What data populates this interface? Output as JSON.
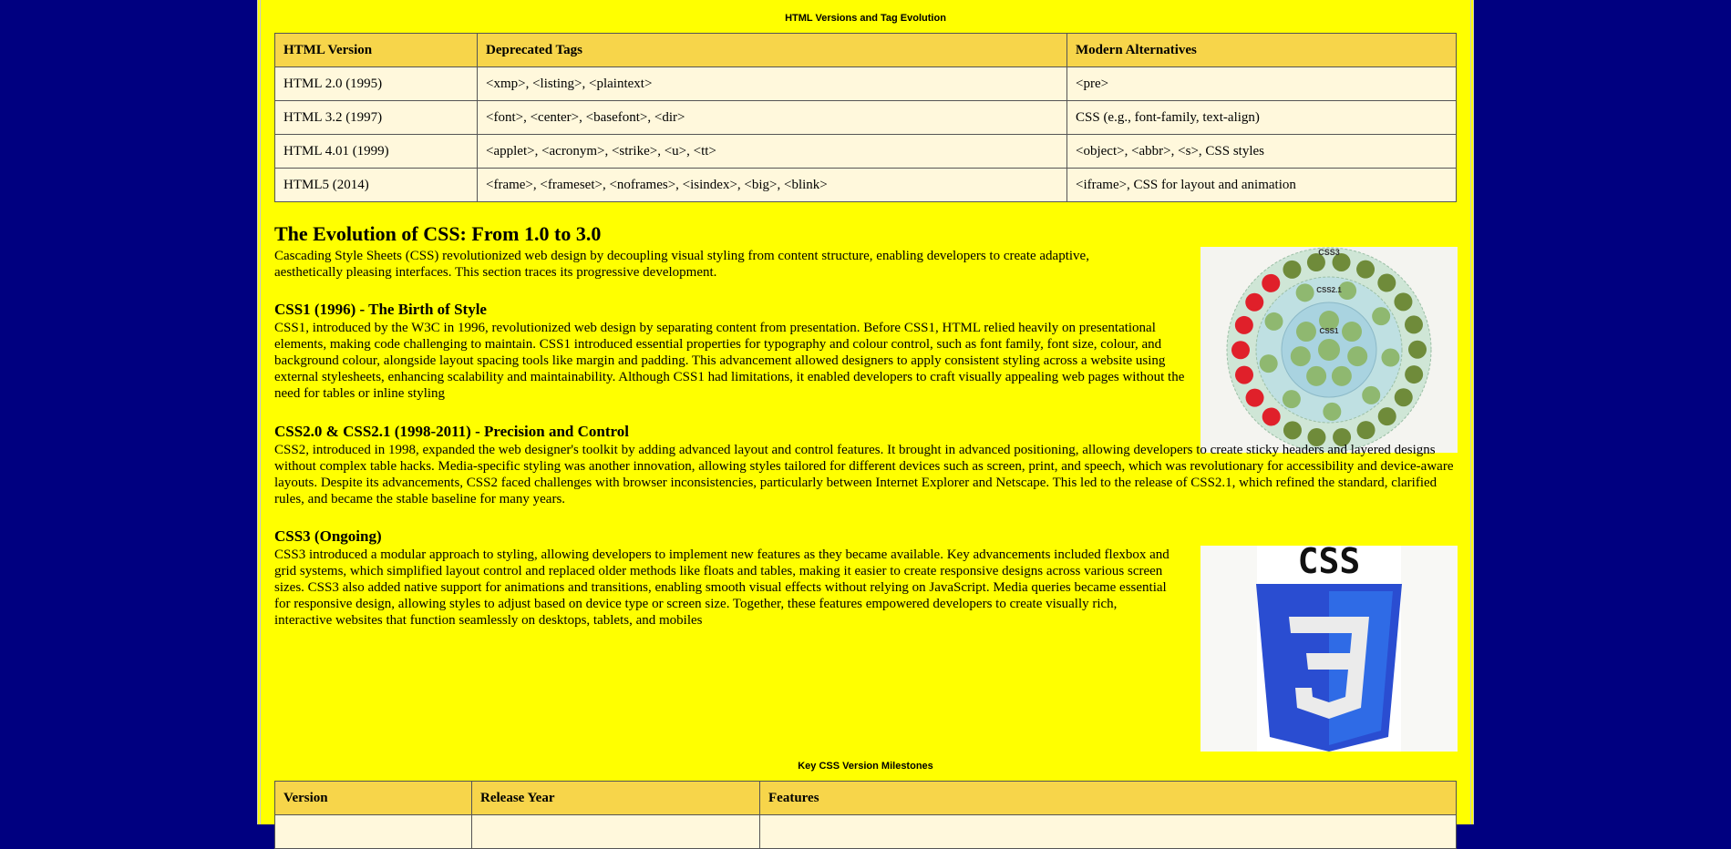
{
  "table1": {
    "caption": "HTML Versions and Tag Evolution",
    "headers": [
      "HTML Version",
      "Deprecated Tags",
      "Modern Alternatives"
    ],
    "rows": [
      [
        "HTML 2.0 (1995)",
        "<xmp>, <listing>, <plaintext>",
        "<pre>"
      ],
      [
        "HTML 3.2 (1997)",
        "<font>, <center>, <basefont>, <dir>",
        "CSS (e.g., font-family, text-align)"
      ],
      [
        "HTML 4.01 (1999)",
        "<applet>, <acronym>, <strike>, <u>, <tt>",
        "<object>, <abbr>, <s>, CSS styles"
      ],
      [
        "HTML5 (2014)",
        "<frame>, <frameset>, <noframes>, <isindex>, <big>, <blink>",
        "<iframe>, CSS for layout and animation"
      ]
    ]
  },
  "css_section": {
    "title": "The Evolution of CSS: From 1.0 to 3.0",
    "intro": "Cascading Style Sheets (CSS) revolutionized web design by decoupling visual styling from content structure, enabling developers to create adaptive, aesthetically pleasing interfaces. This section traces its progressive development.",
    "css1_title": "CSS1 (1996) - The Birth of Style",
    "css1_text": "CSS1, introduced by the W3C in 1996, revolutionized web design by separating content from presentation. Before CSS1, HTML relied heavily on presentational elements, making code challenging to maintain. CSS1 introduced essential properties for typography and colour control, such as font family, font size, colour, and background colour, alongside layout spacing tools like margin and padding. This advancement allowed designers to apply consistent styling across a website using external stylesheets, enhancing scalability and maintainability. Although CSS1 had limitations, it enabled developers to craft visually appealing web pages without the need for tables or inline styling",
    "css2_title": "CSS2.0 & CSS2.1 (1998-2011) - Precision and Control",
    "css2_text": "CSS2, introduced in 1998, expanded the web designer's toolkit by adding advanced layout and control features. It brought in advanced positioning, allowing developers to create sticky headers and layered designs without complex table hacks. Media-specific styling was another innovation, allowing styles tailored for different devices such as screen, print, and speech, which was revolutionary for accessibility and device-aware layouts. Despite its advancements, CSS2 faced challenges with browser inconsistencies, particularly between Internet Explorer and Netscape. This led to the release of CSS2.1, which refined the standard, clarified rules, and became the stable baseline for many years.",
    "css3_title": "CSS3 (Ongoing)",
    "css3_text": "CSS3 introduced a modular approach to styling, allowing developers to implement new features as they became available. Key advancements included flexbox and grid systems, which simplified layout control and replaced older methods like floats and tables, making it easier to create responsive designs across various screen sizes. CSS3 also added native support for animations and transitions, enabling smooth visual effects without relying on JavaScript. Media queries became essential for responsive design, allowing styles to adjust based on device type or screen size. Together, these features empowered developers to create visually rich, interactive websites that function seamlessly on desktops, tablets, and mobiles"
  },
  "diagram": {
    "labels": [
      "CSS3",
      "CSS2.1",
      "CSS1"
    ],
    "colors": {
      "outer": "#6f8b3a",
      "red": "#e0202a",
      "inner": "#8fb870",
      "core": "#a9d3e0"
    }
  },
  "logo": {
    "text": "CSS",
    "colors": {
      "shield_dark": "#2a4dd1",
      "shield_light": "#2f6be6",
      "three": "#ebebeb"
    }
  },
  "table2": {
    "caption": "Key CSS Version Milestones",
    "headers": [
      "Version",
      "Release Year",
      "Features"
    ]
  }
}
